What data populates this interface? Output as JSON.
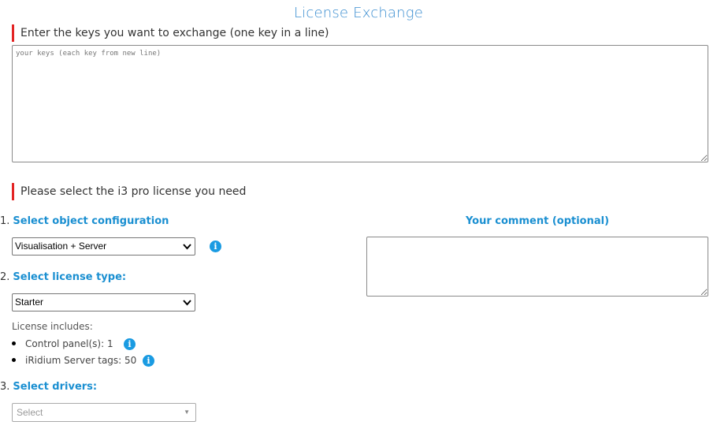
{
  "page": {
    "title": "License Exchange"
  },
  "keys_section": {
    "heading": "Enter the keys you want to exchange (one key in a line)",
    "placeholder": "your keys (each key from new line)"
  },
  "license_section": {
    "heading": "Please select the i3 pro license you need"
  },
  "steps": [
    {
      "number": "1.",
      "label": "Select object configuration"
    },
    {
      "number": "2.",
      "label": "Select license type:"
    },
    {
      "number": "3.",
      "label": "Select drivers:"
    }
  ],
  "object_configuration": {
    "selected": "Visualisation + Server"
  },
  "license_type": {
    "selected": "Starter"
  },
  "includes": {
    "label": "License includes:",
    "items": [
      {
        "text": "Control panel(s): 1"
      },
      {
        "text": "iRidium Server tags: 50"
      }
    ]
  },
  "drivers": {
    "placeholder": "Select"
  },
  "comment": {
    "label": "Your comment (optional)"
  },
  "icons": {
    "info": "info-icon",
    "dropdown": "chevron-down-icon"
  },
  "colors": {
    "accent_blue": "#1a8fd1",
    "title_blue": "#3d8fd1",
    "section_marker_red": "#e32424",
    "info_icon_blue": "#1a9be2"
  }
}
